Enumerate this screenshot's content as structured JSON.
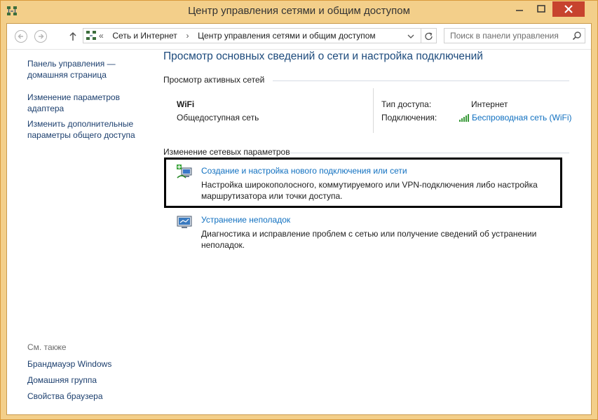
{
  "window": {
    "title": "Центр управления сетями и общим доступом"
  },
  "navbar": {
    "breadcrumb_prefix": "«",
    "breadcrumb": [
      "Сеть и Интернет",
      "Центр управления сетями и общим доступом"
    ],
    "breadcrumb_separator": "›",
    "search_placeholder": "Поиск в панели управления"
  },
  "sidebar": {
    "items": [
      {
        "label": "Панель управления — домашняя страница"
      },
      {
        "label": "Изменение параметров адаптера"
      },
      {
        "label": "Изменить дополнительные параметры общего доступа"
      }
    ],
    "see_also_label": "См. также",
    "see_also": [
      {
        "label": "Брандмауэр Windows"
      },
      {
        "label": "Домашняя группа"
      },
      {
        "label": "Свойства браузера"
      }
    ]
  },
  "main": {
    "title": "Просмотр основных сведений о сети и настройка подключений",
    "active_networks": {
      "heading": "Просмотр активных сетей",
      "network_name": "WiFi",
      "network_type": "Общедоступная сеть",
      "access_type_label": "Тип доступа:",
      "access_type_value": "Интернет",
      "connections_label": "Подключения:",
      "connections_value": "Беспроводная сеть (WiFi)"
    },
    "change_settings": {
      "heading": "Изменение сетевых параметров",
      "tasks": [
        {
          "title": "Создание и настройка нового подключения или сети",
          "description": "Настройка широкополосного, коммутируемого или VPN-подключения либо настройка маршрутизатора или точки доступа."
        },
        {
          "title": "Устранение неполадок",
          "description": "Диагностика и исправление проблем с сетью или получение сведений об устранении неполадок."
        }
      ]
    }
  },
  "colors": {
    "frame": "#f3cf8a",
    "close_button": "#c7432e",
    "link": "#1070c0",
    "title": "#1c4a7c"
  }
}
